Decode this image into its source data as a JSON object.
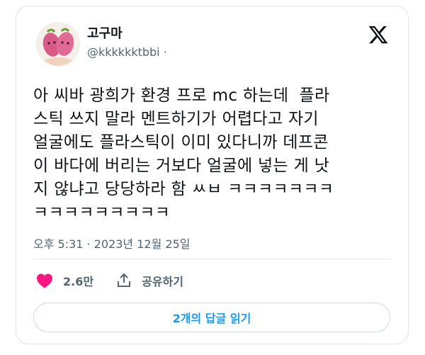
{
  "author": {
    "display_name": "고구마",
    "handle": "@kkkkkktbbi",
    "handle_suffix": "·"
  },
  "brand": {
    "logo_icon": "x-logo-icon"
  },
  "tweet": {
    "lines": [
      "아 씨바 광희가 환경 프로 mc 하는데  플라",
      "스틱 쓰지 말라 멘트하기가 어렵다고 자기",
      "얼굴에도 플라스틱이 이미 있다니까 데프콘",
      "이 바다에 버리는 거보다 얼굴에 넣는 게 낫",
      "지 않냐고 당당하라 함 ㅆㅂ ㅋㅋㅋㅋㅋㅋㅋ",
      "ㅋㅋㅋㅋㅋㅋㅋㅋㅋ"
    ],
    "timestamp": "오후 5:31 · 2023년 12월 25일"
  },
  "actions": {
    "like": {
      "icon": "heart-icon",
      "count": "2.6만",
      "color": "#f91880"
    },
    "share": {
      "icon": "share-icon",
      "label": "공유하기"
    }
  },
  "replies_button": {
    "label": "2개의 답글 읽기",
    "color": "#1d9bf0"
  }
}
